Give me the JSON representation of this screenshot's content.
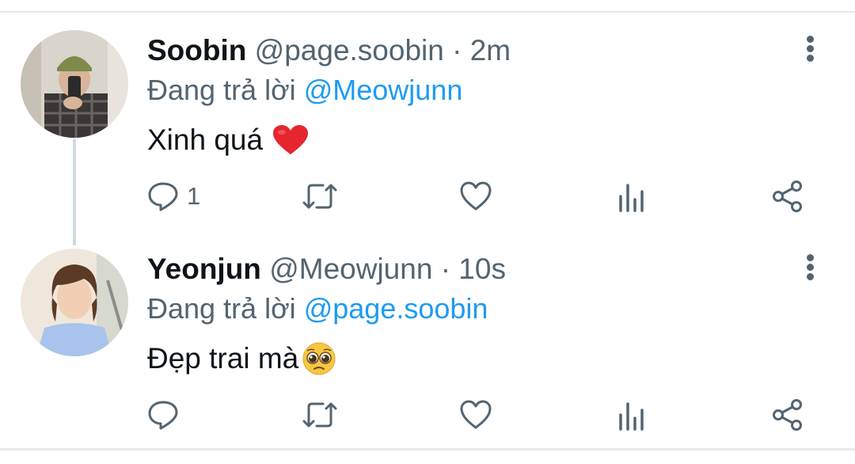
{
  "tweets": [
    {
      "name": "Soobin",
      "handle": "@page.soobin",
      "separator": "·",
      "time": "2m",
      "replying_prefix": "Đang trả lời",
      "replying_to": "@Meowjunn",
      "text": "Xinh quá",
      "emoji": "heart",
      "reply_count": "1",
      "retweet_count": "",
      "like_count": ""
    },
    {
      "name": "Yeonjun",
      "handle": "@Meowjunn",
      "separator": "·",
      "time": "10s",
      "replying_prefix": "Đang trả lời",
      "replying_to": "@page.soobin",
      "text": "Đẹp trai mà",
      "emoji": "pleading-face",
      "reply_count": "",
      "retweet_count": "",
      "like_count": ""
    }
  ],
  "colors": {
    "text": "#0f1419",
    "secondary": "#536471",
    "link": "#1d9bf0",
    "divider": "#e6e9ec",
    "thread_line": "#cfd9de",
    "heart": "#e5262e"
  },
  "icons": [
    "reply-icon",
    "retweet-icon",
    "like-icon",
    "analytics-icon",
    "share-icon",
    "more-options-icon"
  ]
}
